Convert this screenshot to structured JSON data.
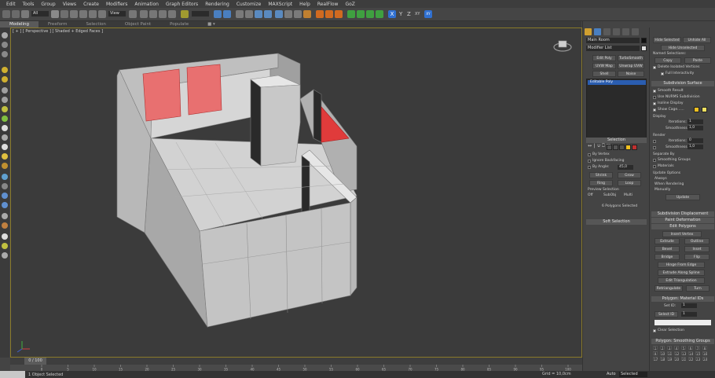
{
  "menu": [
    "Edit",
    "Tools",
    "Group",
    "Views",
    "Create",
    "Modifiers",
    "Animation",
    "Graph Editors",
    "Rendering",
    "Customize",
    "MAXScript",
    "Help",
    "RealFlow",
    "GoZ"
  ],
  "ribbon": {
    "tabs": [
      "Modeling",
      "Freeform",
      "Selection",
      "Object Paint",
      "Populate"
    ],
    "active": "Modeling"
  },
  "toolbar": {
    "selection_filter": "All",
    "ref_coord": "View",
    "axis_labels": [
      "X",
      "Y",
      "Z",
      "XY"
    ]
  },
  "viewport": {
    "label": "[ + ] [ Perspective ] [ Shaded + Edged Faces ]",
    "active_border_color": "#8a7a2a"
  },
  "timeline": {
    "frame_display": "0 / 100",
    "ticks": [
      "0",
      "5",
      "10",
      "15",
      "20",
      "25",
      "30",
      "35",
      "40",
      "45",
      "50",
      "55",
      "60",
      "65",
      "70",
      "75",
      "80",
      "85",
      "90",
      "95",
      "100"
    ]
  },
  "status": {
    "selection_text": "1 Object Selected",
    "grid": "Grid = 10,0cm",
    "auto_key": "Auto",
    "key_filter": "Selected"
  },
  "command_panel": {
    "object_name": "Main Room",
    "modifier_list": "Modifier List",
    "buttons": [
      "Edit Poly",
      "TurboSmooth",
      "UVW Map",
      "Unwrap UVW",
      "Shell",
      "Noise"
    ],
    "stack_item": "Editable Poly",
    "selection_rollout": "Selection",
    "selection_options": [
      "By Vertex",
      "Ignore Backfacing",
      "By Angle:"
    ],
    "angle_value": "45,0",
    "shrink": "Shrink",
    "grow": "Grow",
    "ring": "Ring",
    "loop": "Loop",
    "preview_label": "Preview Selection",
    "preview_options": [
      "Off",
      "SubObj",
      "Multi"
    ],
    "count_text": "6 Polygons Selected",
    "soft_selection": "Soft Selection"
  },
  "right_panel": {
    "hide_selected": "Hide Selected",
    "unhide_all": "Unhide All",
    "hide_unselected": "Hide Unselected",
    "named_selections": "Named Selections:",
    "copy": "Copy",
    "paste": "Paste",
    "delete_isolated": "Delete Isolated Vertices",
    "full_interactivity": "Full Interactivity",
    "subdivision_surface": "Subdivision Surface",
    "smooth_result": "Smooth Result",
    "use_nurms": "Use NURMS Subdivision",
    "isoline_display": "Isoline Display",
    "show_cage": "Show Cage......",
    "cage_colors": [
      "#f0c020",
      "#f0e060"
    ],
    "display_label": "Display",
    "iterations_label": "Iterations:",
    "iterations_value": "1",
    "smoothness_label": "Smoothness:",
    "smoothness_value": "1,0",
    "render_label": "Render",
    "render_iterations": "0",
    "render_smoothness": "1,0",
    "separate_by": "Separate By",
    "smoothing_groups": "Smoothing Groups",
    "materials": "Materials",
    "update_options": "Update Options",
    "always": "Always",
    "when_rendering": "When Rendering",
    "manually": "Manually",
    "update": "Update",
    "subdivision_displacement": "Subdivision Displacement",
    "paint_deformation": "Paint Deformation",
    "edit_polygons": "Edit Polygons",
    "insert_vertex": "Insert Vertex",
    "extrude": "Extrude",
    "outline": "Outline",
    "bevel": "Bevel",
    "inset": "Inset",
    "bridge": "Bridge",
    "flip": "Flip",
    "hinge": "Hinge From Edge",
    "extrude_spline": "Extrude Along Spline",
    "edit_triangulation": "Edit Triangulation",
    "retriangulate": "Retriangulate",
    "turn": "Turn",
    "material_ids": "Polygon: Material IDs",
    "set_id": "Set ID:",
    "set_id_value": "1",
    "select_id": "Select ID",
    "select_id_value": "1",
    "clear_selection": "Clear Selection",
    "smoothing_groups_title": "Polygon: Smoothing Groups",
    "sg_numbers": [
      "1",
      "2",
      "3",
      "4",
      "5",
      "6",
      "7",
      "8",
      "9",
      "10",
      "11",
      "12",
      "13",
      "14",
      "15",
      "16",
      "17",
      "18",
      "19",
      "20",
      "21",
      "22",
      "23",
      "24"
    ]
  }
}
